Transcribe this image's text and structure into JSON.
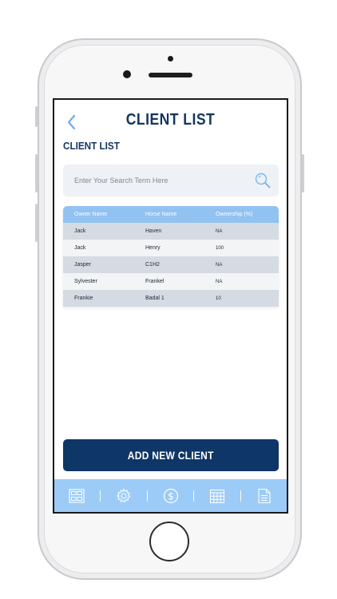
{
  "header": {
    "title": "CLIENT LIST",
    "back_icon": "chevron-left-icon"
  },
  "section": {
    "title": "CLIENT LIST"
  },
  "search": {
    "placeholder": "Enter Your Search Term Here",
    "value": "",
    "icon": "search-icon"
  },
  "table": {
    "columns": [
      "Owner Name",
      "Horse Name",
      "Ownership (%)"
    ],
    "rows": [
      [
        "Jack",
        "Haven",
        "NA"
      ],
      [
        "Jack",
        "Henry",
        "100"
      ],
      [
        "Jasper",
        "C1H2",
        "NA"
      ],
      [
        "Sylvester",
        "Frankel",
        "NA"
      ],
      [
        "Frankie",
        "Badal 1",
        "10"
      ]
    ]
  },
  "actions": {
    "add_client_label": "ADD NEW CLIENT"
  },
  "tabbar": {
    "items": [
      "dashboard-icon",
      "settings-icon",
      "billing-icon",
      "calendar-icon",
      "document-icon"
    ]
  },
  "colors": {
    "brand_navy": "#14365e",
    "button_navy": "#0e3666",
    "accent_blue": "#92c2f2",
    "tabbar_blue": "#9ccbf8",
    "row_alt": "#d5dbe2"
  }
}
